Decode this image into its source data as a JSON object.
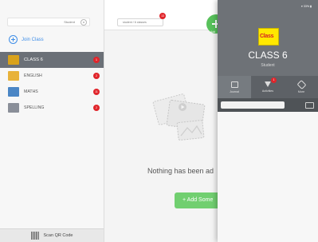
{
  "status_bar": {
    "time": "20:17  Mon 16 Mar",
    "battery": "▾ 33% ▮"
  },
  "sidebar": {
    "student_label": "Student",
    "join_label": "Join Class",
    "classes": [
      {
        "label": "CLASS 6",
        "badge": "1",
        "active": true,
        "color": "#d9a21b"
      },
      {
        "label": "ENGLISH",
        "badge": "2",
        "active": false,
        "color": "#e8b23a"
      },
      {
        "label": "MATHS",
        "badge": "11",
        "active": false,
        "color": "#4b86c5"
      },
      {
        "label": "SPELLING",
        "badge": "2",
        "active": false,
        "color": "#8a8f99"
      }
    ],
    "scan_label": "Scan QR Code"
  },
  "main": {
    "tab_label": "student / 6 classes",
    "tab_badge": "13",
    "add_label": "Add",
    "empty_title": "Nothing has been ad",
    "add_some_label": "+ Add Some"
  },
  "panel": {
    "logo_text": "Class",
    "title": "CLASS 6",
    "subtitle": "Student",
    "tabs": [
      {
        "label": "Journal",
        "icon": "journal-icon",
        "active": true
      },
      {
        "label": "Activities",
        "icon": "filter-icon",
        "active": false,
        "badge": "1"
      },
      {
        "label": "More",
        "icon": "tag-icon",
        "active": false
      }
    ]
  }
}
